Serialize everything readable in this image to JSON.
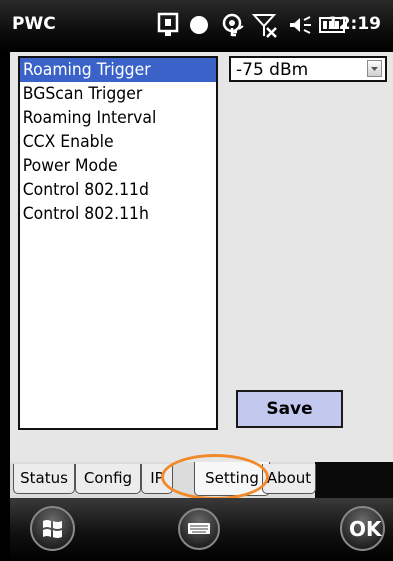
{
  "status_bar": {
    "app_title": "PWC",
    "time": "12:19",
    "icons": [
      "sync-icon",
      "record-dot-icon",
      "wifi-key-icon",
      "no-signal-icon",
      "speaker-icon",
      "battery-icon"
    ]
  },
  "settings_list": {
    "items": [
      {
        "label": "Roaming Trigger",
        "selected": true
      },
      {
        "label": "BGScan Trigger",
        "selected": false
      },
      {
        "label": "Roaming Interval",
        "selected": false
      },
      {
        "label": "CCX Enable",
        "selected": false
      },
      {
        "label": "Power Mode",
        "selected": false
      },
      {
        "label": "Control 802.11d",
        "selected": false
      },
      {
        "label": "Control 802.11h",
        "selected": false
      }
    ]
  },
  "value_select": {
    "selected": "-75 dBm"
  },
  "save_label": "Save",
  "tabs": [
    {
      "label": "Status",
      "active": false
    },
    {
      "label": "Config",
      "active": false
    },
    {
      "label": "IP",
      "active": false
    },
    {
      "label": "Setting",
      "active": true
    },
    {
      "label": "About",
      "active": false
    }
  ],
  "soft_keys": {
    "ok_label": "OK"
  },
  "colors": {
    "selection": "#3a62c8",
    "save_button": "#c3c8ee",
    "highlight_ellipse": "#f08a2a"
  }
}
